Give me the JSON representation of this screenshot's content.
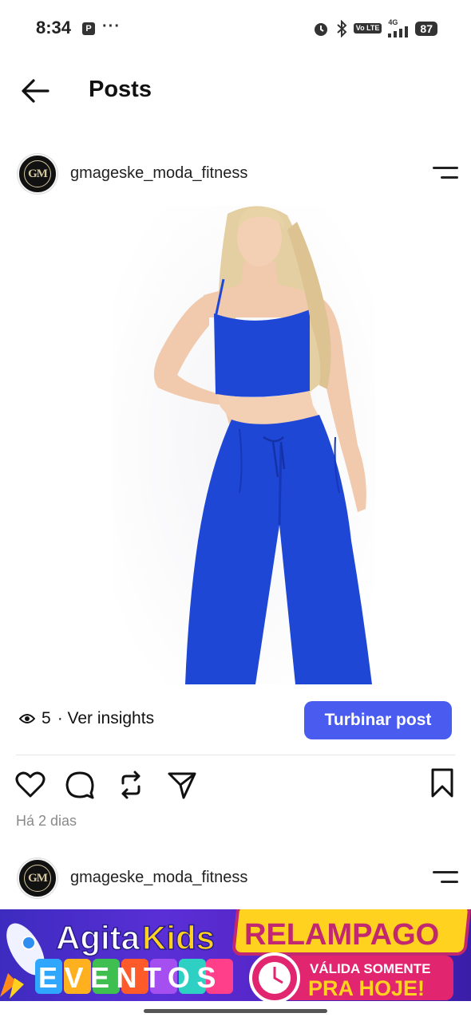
{
  "status_bar": {
    "time": "8:34",
    "app_icon": "P",
    "dots": "···",
    "network": "4G",
    "volte": "Vo LTE",
    "battery": "87"
  },
  "header": {
    "title": "Posts"
  },
  "posts": [
    {
      "username": "gmageske_moda_fitness",
      "avatar_text": "GM",
      "views": "5",
      "insights_label": "· Ver insights",
      "boost_label": "Turbinar post",
      "date": "Há 2 dias"
    },
    {
      "username": "gmageske_moda_fitness",
      "avatar_text": "GM"
    }
  ],
  "banner": {
    "brand_part1": "Agita",
    "brand_part2": "Kids",
    "word": "EVENTOS",
    "promo": "RELAMPAGO",
    "valid_line": "VÁLIDA SOMENTE",
    "valid_emph": "PRA HOJE!"
  },
  "colors": {
    "accent": "#4a5cf0",
    "outfit": "#1f47d6",
    "banner_bg": "#4b2ac8",
    "banner_yellow": "#ffd21f",
    "banner_pink": "#e2256f"
  },
  "icons": [
    "back-arrow-icon",
    "menu-icon",
    "eye-icon",
    "heart-icon",
    "comment-icon",
    "repost-icon",
    "send-icon",
    "bookmark-icon"
  ]
}
